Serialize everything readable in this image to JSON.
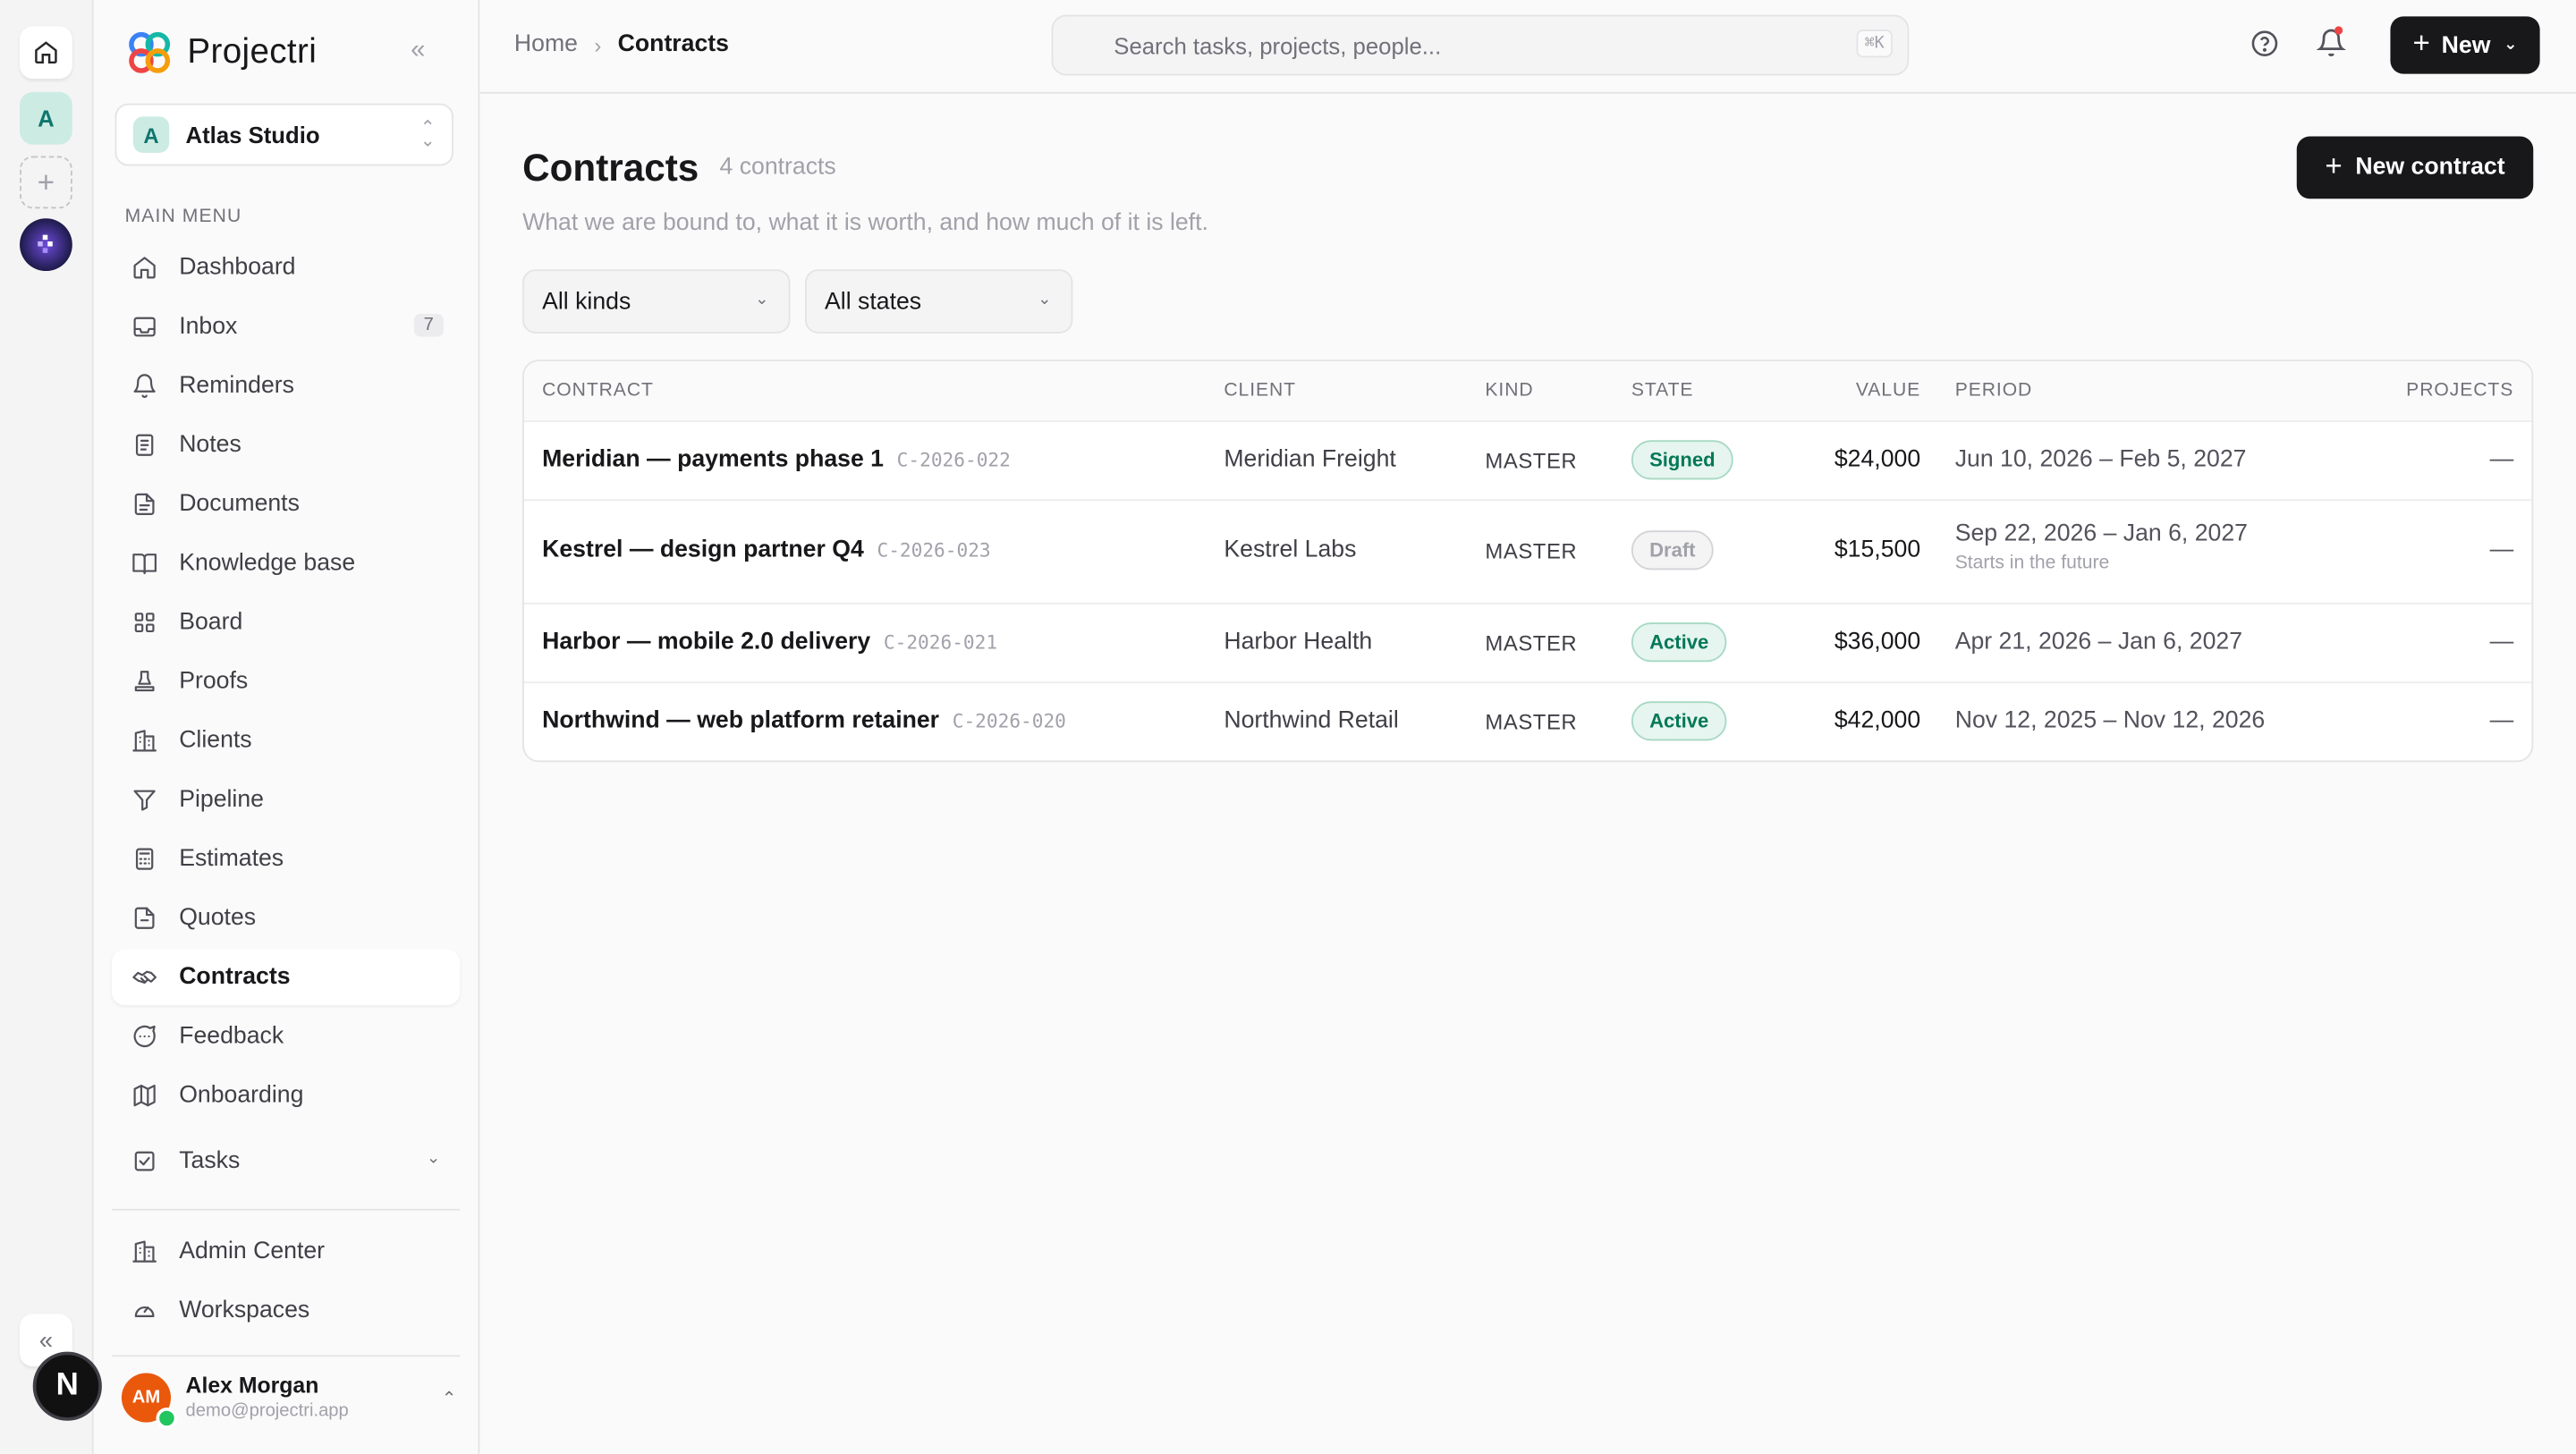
{
  "app": {
    "name": "Projectri"
  },
  "rail": {
    "workspace_initial": "A",
    "add_glyph": "+",
    "collapse_glyph": "«",
    "n_badge": "N"
  },
  "workspace": {
    "initial": "A",
    "name": "Atlas Studio"
  },
  "sidebar": {
    "menu_label": "MAIN MENU",
    "items": [
      {
        "label": "Dashboard",
        "icon": "home-icon"
      },
      {
        "label": "Inbox",
        "icon": "inbox-icon",
        "count": "7"
      },
      {
        "label": "Reminders",
        "icon": "bell-icon"
      },
      {
        "label": "Notes",
        "icon": "note-icon"
      },
      {
        "label": "Documents",
        "icon": "document-icon"
      },
      {
        "label": "Knowledge base",
        "icon": "book-icon"
      },
      {
        "label": "Board",
        "icon": "grid-icon"
      },
      {
        "label": "Proofs",
        "icon": "stamp-icon"
      },
      {
        "label": "Clients",
        "icon": "building-icon"
      },
      {
        "label": "Pipeline",
        "icon": "funnel-icon"
      },
      {
        "label": "Estimates",
        "icon": "calculator-icon"
      },
      {
        "label": "Quotes",
        "icon": "quote-doc-icon"
      },
      {
        "label": "Contracts",
        "icon": "handshake-icon",
        "active": true
      },
      {
        "label": "Feedback",
        "icon": "chat-icon"
      },
      {
        "label": "Onboarding",
        "icon": "map-icon"
      },
      {
        "label": "Tasks",
        "icon": "checkbox-icon"
      }
    ],
    "admin": [
      {
        "label": "Admin Center",
        "icon": "building-icon"
      },
      {
        "label": "Workspaces",
        "icon": "gauge-icon"
      }
    ]
  },
  "user": {
    "initials": "AM",
    "name": "Alex Morgan",
    "email": "demo@projectri.app"
  },
  "topbar": {
    "breadcrumb": {
      "home": "Home",
      "current": "Contracts"
    },
    "search_placeholder": "Search tasks, projects, people...",
    "search_shortcut": "⌘K",
    "new_label": "New"
  },
  "page": {
    "title": "Contracts",
    "count": "4 contracts",
    "subtitle": "What we are bound to, what it is worth, and how much of it is left.",
    "new_contract_label": "New contract",
    "filters": {
      "kind": "All kinds",
      "state": "All states"
    }
  },
  "table": {
    "columns": {
      "contract": "CONTRACT",
      "client": "CLIENT",
      "kind": "KIND",
      "state": "STATE",
      "value": "VALUE",
      "period": "PERIOD",
      "projects": "PROJECTS"
    },
    "rows": [
      {
        "name": "Meridian — payments phase 1",
        "code": "C-2026-022",
        "client": "Meridian Freight",
        "kind": "MASTER",
        "state": "Signed",
        "state_key": "signed",
        "value": "$24,000",
        "period": "Jun 10, 2026 – Feb 5, 2027",
        "period_note": "",
        "projects": "—"
      },
      {
        "name": "Kestrel — design partner Q4",
        "code": "C-2026-023",
        "client": "Kestrel Labs",
        "kind": "MASTER",
        "state": "Draft",
        "state_key": "draft",
        "value": "$15,500",
        "period": "Sep 22, 2026 – Jan 6, 2027",
        "period_note": "Starts in the future",
        "projects": "—"
      },
      {
        "name": "Harbor — mobile 2.0 delivery",
        "code": "C-2026-021",
        "client": "Harbor Health",
        "kind": "MASTER",
        "state": "Active",
        "state_key": "active",
        "value": "$36,000",
        "period": "Apr 21, 2026 – Jan 6, 2027",
        "period_note": "",
        "projects": "—"
      },
      {
        "name": "Northwind — web platform retainer",
        "code": "C-2026-020",
        "client": "Northwind Retail",
        "kind": "MASTER",
        "state": "Active",
        "state_key": "active",
        "value": "$42,000",
        "period": "Nov 12, 2025 – Nov 12, 2026",
        "period_note": "",
        "projects": "—"
      }
    ]
  }
}
